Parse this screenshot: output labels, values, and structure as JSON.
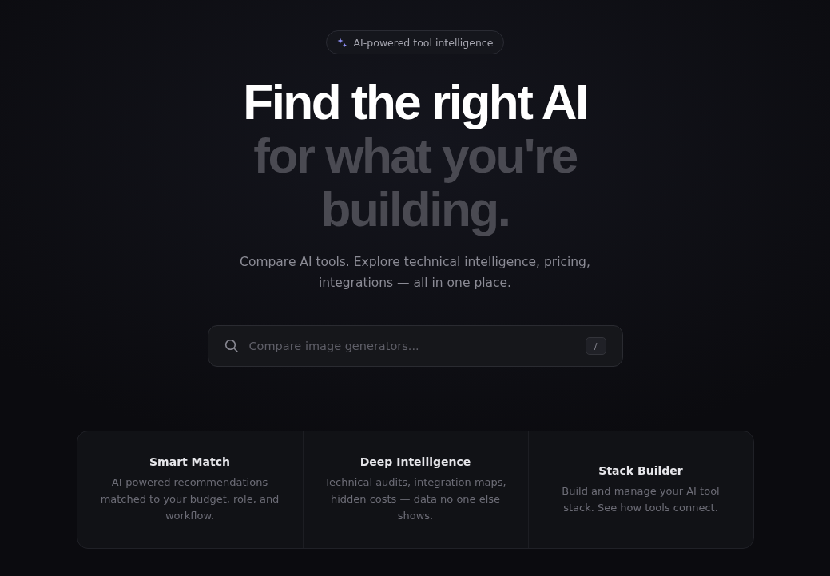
{
  "badge": {
    "label": "AI-powered tool intelligence"
  },
  "headline": {
    "primary": "Find the right AI",
    "secondary": "for what you're building."
  },
  "subtitle": "Compare AI tools. Explore technical intelligence, pricing, integrations — all in one place.",
  "search": {
    "placeholder": "Compare image generators...",
    "shortcut": "/"
  },
  "features": [
    {
      "title": "Smart Match",
      "description": "AI-powered recommendations matched to your budget, role, and workflow."
    },
    {
      "title": "Deep Intelligence",
      "description": "Technical audits, integration maps, hidden costs — data no one else shows."
    },
    {
      "title": "Stack Builder",
      "description": "Build and manage your AI tool stack. See how tools connect."
    }
  ]
}
